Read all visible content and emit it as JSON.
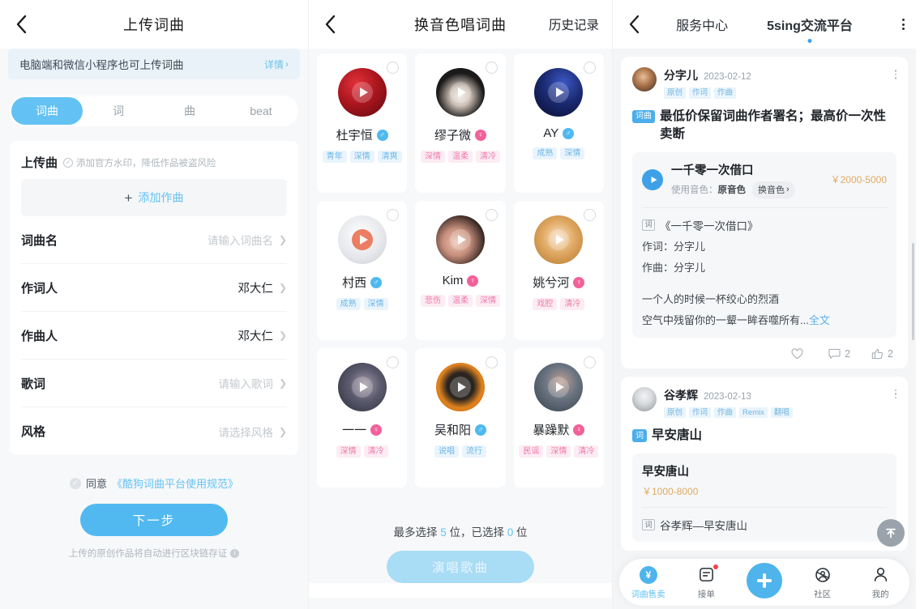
{
  "panel1": {
    "header": {
      "back_icon": "back-chevron-icon",
      "title": "上传词曲"
    },
    "notice": {
      "text": "电脑端和微信小程序也可上传词曲",
      "link": "详情",
      "chevron": "›"
    },
    "segments": [
      {
        "label": "词曲",
        "active": true
      },
      {
        "label": "词",
        "active": false
      },
      {
        "label": "曲",
        "active": false
      },
      {
        "label": "beat",
        "active": false
      }
    ],
    "upload": {
      "label": "上传曲",
      "hint": "添加官方水印，降低作品被盗风险",
      "add_label": "添加作曲",
      "plus": "+"
    },
    "fields": [
      {
        "label": "词曲名",
        "value": "",
        "placeholder": "请输入词曲名"
      },
      {
        "label": "作词人",
        "value": "邓大仁",
        "placeholder": ""
      },
      {
        "label": "作曲人",
        "value": "邓大仁",
        "placeholder": ""
      },
      {
        "label": "歌词",
        "value": "",
        "placeholder": "请输入歌词"
      },
      {
        "label": "风格",
        "value": "",
        "placeholder": "请选择风格"
      }
    ],
    "agree": {
      "prefix": "同意",
      "link": "《酷狗词曲平台使用规范》"
    },
    "next_button": "下一步",
    "footnote": "上传的原创作品将自动进行区块链存证"
  },
  "panel2": {
    "header": {
      "back_icon": "back-chevron-icon",
      "title": "换音色唱词曲",
      "history": "历史记录"
    },
    "cards": [
      {
        "name": "杜宇恒",
        "gender": "male",
        "tags": [
          "青年",
          "深情",
          "清爽"
        ],
        "tag_color": "blue",
        "avatar": "#8f1018",
        "avatar2": "#d5242b"
      },
      {
        "name": "缪子微",
        "gender": "female",
        "tags": [
          "深情",
          "温柔",
          "清冷"
        ],
        "tag_color": "pink",
        "avatar": "#1c1c1c",
        "avatar2": "#e8e2dd"
      },
      {
        "name": "AY",
        "gender": "male",
        "tags": [
          "成熟",
          "深情"
        ],
        "tag_color": "blue",
        "avatar": "#101a4d",
        "avatar2": "#2c3f8f"
      },
      {
        "name": "村西",
        "gender": "male",
        "tags": [
          "成熟",
          "深情"
        ],
        "tag_color": "blue",
        "avatar": "#dcdee2",
        "avatar2": "#f0f1f3"
      },
      {
        "name": "Kim",
        "gender": "female",
        "tags": [
          "悲伤",
          "温柔",
          "深情"
        ],
        "tag_color": "pink",
        "avatar": "#231a18",
        "avatar2": "#e0b2a4"
      },
      {
        "name": "姚兮河",
        "gender": "female",
        "tags": [
          "戏腔",
          "清冷"
        ],
        "tag_color": "pink",
        "avatar": "#c9813f",
        "avatar2": "#f2d9b8"
      },
      {
        "name": "一一",
        "gender": "female",
        "tags": [
          "深情",
          "清冷"
        ],
        "tag_color": "pink",
        "avatar": "#3a3d4a",
        "avatar2": "#8d8fa0"
      },
      {
        "name": "吴和阳",
        "gender": "male",
        "tags": [
          "说唱",
          "流行"
        ],
        "tag_color": "blue",
        "avatar": "#d5751a",
        "avatar2": "#2a2520"
      },
      {
        "name": "暴躁默",
        "gender": "female",
        "tags": [
          "民谣",
          "深情",
          "清冷"
        ],
        "tag_color": "pink",
        "avatar": "#46505c",
        "avatar2": "#9aa5b0"
      }
    ],
    "footer": {
      "count_prefix": "最多选择",
      "max": "5",
      "count_mid": "位，已选择",
      "selected": "0",
      "count_suffix": "位",
      "sing_button": "演唱歌曲"
    }
  },
  "panel3": {
    "header": {
      "back_icon": "back-chevron-icon",
      "tabs": [
        {
          "label": "服务中心",
          "active": false
        },
        {
          "label": "5sing交流平台",
          "active": true
        }
      ],
      "more_icon": "more-vertical-icon"
    },
    "posts": [
      {
        "author": "分字儿",
        "date": "2023-02-12",
        "role_tags": [
          "原创",
          "作词",
          "作曲"
        ],
        "category": "词曲",
        "title": "最低价保留词曲作者署名；最高价一次性卖断",
        "work": {
          "title": "一千零一次借口",
          "sub_label": "使用音色：",
          "sub_value": "原音色",
          "switch": "换音色",
          "switch_chevron": "›",
          "price": "￥2000-5000"
        },
        "lyric_badge": "词",
        "lyric_title": "《一千零一次借口》",
        "credits": [
          "作词：分字儿",
          "作曲：分字儿"
        ],
        "lyrics": [
          "一个人的时候一杯绞心的烈酒",
          "空气中残留你的一颦一眸吞噬所有..."
        ],
        "more_label": "全文",
        "actions": {
          "like_icon": "heart-icon",
          "like_count": "",
          "comment_icon": "comment-icon",
          "comment_count": "2",
          "thumb_icon": "thumbs-up-icon",
          "thumb_count": "2"
        }
      },
      {
        "author": "谷孝辉",
        "date": "2023-02-13",
        "role_tags": [
          "原创",
          "作词",
          "作曲",
          "Remix",
          "翻唱"
        ],
        "category": "词",
        "title": "早安唐山",
        "work": {
          "title": "早安唐山",
          "price": "￥1000-8000"
        },
        "lyric_badge": "词",
        "lyric_title": "谷孝辉—早安唐山"
      }
    ],
    "fab_top_icon": "scroll-to-top-icon",
    "tabbar": [
      {
        "label": "词曲售卖",
        "icon": "yen-circle-icon",
        "active": true,
        "badge": false
      },
      {
        "label": "接单",
        "icon": "order-list-icon",
        "active": false,
        "badge": true
      },
      {
        "label": "",
        "icon": "plus-icon",
        "active": false,
        "badge": false,
        "is_fab": true
      },
      {
        "label": "社区",
        "icon": "community-icon",
        "active": false,
        "badge": false
      },
      {
        "label": "我的",
        "icon": "person-icon",
        "active": false,
        "badge": false
      }
    ]
  }
}
